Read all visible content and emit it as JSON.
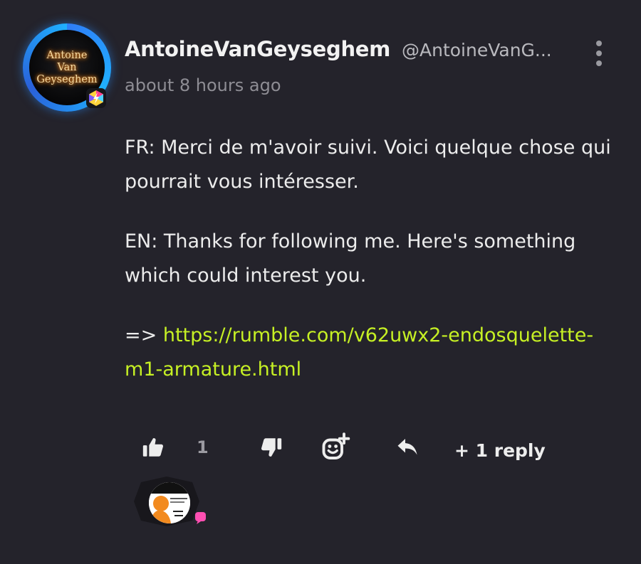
{
  "comment": {
    "author": {
      "avatar_text": [
        "Antoine",
        "Van",
        "Geyseghem"
      ],
      "name": "AntoineVanGeyseghem",
      "handle": "@AntoineVanG..."
    },
    "timestamp": "about 8 hours ago",
    "body": {
      "paragraph_fr": "FR: Merci de m'avoir suivi. Voici quelque chose qui pourrait vous intéresser.",
      "paragraph_en": "EN: Thanks for following me. Here's something which could interest you.",
      "link_prefix": "=> ",
      "link_text": "https://rumble.com/v62uwx2-endosquelette-m1-armature.html"
    },
    "actions": {
      "like_count": "1",
      "reply_label": "+ 1 reply"
    },
    "icons": {
      "menu": "more-vertical-icon",
      "like": "thumbs-up-icon",
      "dislike": "thumbs-down-icon",
      "reaction": "add-reaction-icon",
      "reply": "reply-icon",
      "badge": "bolt-badge-icon"
    },
    "colors": {
      "background": "#24232b",
      "link": "#c6f024",
      "avatar_ring": "#1fb0ff",
      "reply_dot": "#ff4fb2"
    }
  }
}
